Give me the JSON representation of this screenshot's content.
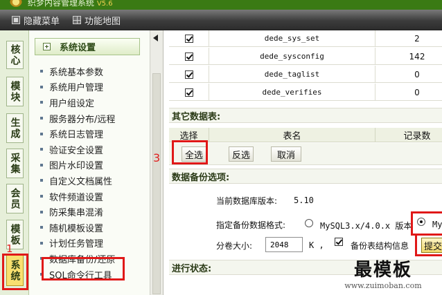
{
  "app": {
    "title": "织梦内容管理系统",
    "version": "V5.6"
  },
  "menubar": {
    "items": [
      {
        "label": "隐藏菜单",
        "icon": "hide-menu-icon"
      },
      {
        "label": "功能地图",
        "icon": "function-map-icon"
      }
    ]
  },
  "vtabs": [
    "核心",
    "模块",
    "生成",
    "采集",
    "会员",
    "模板",
    "系统"
  ],
  "vtabs_active": "系统",
  "sidebar": {
    "header": "系统设置",
    "items": [
      "系统基本参数",
      "系统用户管理",
      "用户组设定",
      "服务器分布/远程",
      "系统日志管理",
      "验证安全设置",
      "图片水印设置",
      "自定义文档属性",
      "软件频道设置",
      "防采集串混淆",
      "随机模板设置",
      "计划任务管理",
      "数据库备份/还原",
      "SQL命令行工具"
    ],
    "active": "数据库备份/还原"
  },
  "annotations": {
    "marker_1": "1",
    "marker_3": "3"
  },
  "tables": [
    {
      "checked": true,
      "name": "dede_sys_set",
      "count": "2"
    },
    {
      "checked": true,
      "name": "dede_sysconfig",
      "count": "142"
    },
    {
      "checked": true,
      "name": "dede_taglist",
      "count": "0"
    },
    {
      "checked": true,
      "name": "dede_verifies",
      "count": "0"
    }
  ],
  "other_tables": {
    "title": "其它数据表:",
    "col_select": "选择",
    "col_name": "表名",
    "col_count": "记录数",
    "btn_select_all": "全选",
    "btn_invert": "反选",
    "btn_cancel": "取消"
  },
  "backup_options": {
    "title": "数据备份选项:",
    "db_version_label": "当前数据库版本:",
    "db_version": "5.10",
    "format_label": "指定备份数据格式:",
    "format_option_1": "MySQL3.x/4.0.x 版本",
    "format_option_2": "My",
    "format_selected": "My",
    "volume_label": "分卷大小:",
    "volume_size": "2048",
    "volume_unit": "K ,",
    "backup_structure_label": "备份表结构信息",
    "backup_structure_checked": true,
    "submit_label": "提交"
  },
  "progress": {
    "title": "进行状态:"
  },
  "watermark": {
    "text": "最模板",
    "url": "www.zuimoban.com"
  }
}
